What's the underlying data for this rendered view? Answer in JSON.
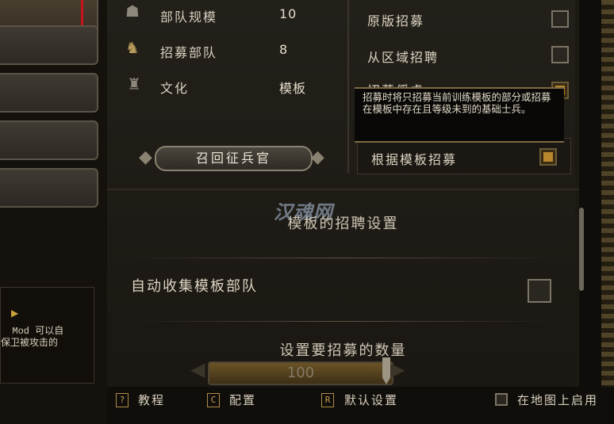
{
  "summary": {
    "troop_size_label": "部队规模",
    "troop_size_value": "10",
    "recruit_troops_label": "招募部队",
    "recruit_troops_value": "8",
    "culture_label": "文化",
    "culture_value": "模板"
  },
  "recall_button_label": "召回征兵官",
  "options": {
    "vanilla_recruit_label": "原版招募",
    "region_recruit_label": "从区域招聘",
    "partial_label": "招募俘虏",
    "template_recruit_label": "根据模板招募"
  },
  "tooltip_text": "招募时将只招募当前训练模板的部分或招募在模板中存在且等级未到的基础士兵。",
  "watermark_text": "汉魂网",
  "section_title": "模板的招聘设置",
  "auto_collect_label": "自动收集模板部队",
  "count_title": "设置要招募的数量",
  "slider_value": "100",
  "left_tip": {
    "text": "  Mod 可以自\n保卫被攻击的"
  },
  "bottom": {
    "tutorial_key": "?",
    "tutorial_label": "教程",
    "config_key": "C",
    "config_label": "配置",
    "default_key": "R",
    "default_label": "默认设置",
    "map_enable_label": "在地图上启用"
  },
  "checkbox_states": {
    "vanilla_recruit": false,
    "region_recruit": false,
    "partial": true,
    "template_recruit": true,
    "auto_collect": false,
    "map_enable": false
  },
  "colors": {
    "accent_gold": "#b8862d",
    "highlight_red": "#c8141a"
  }
}
